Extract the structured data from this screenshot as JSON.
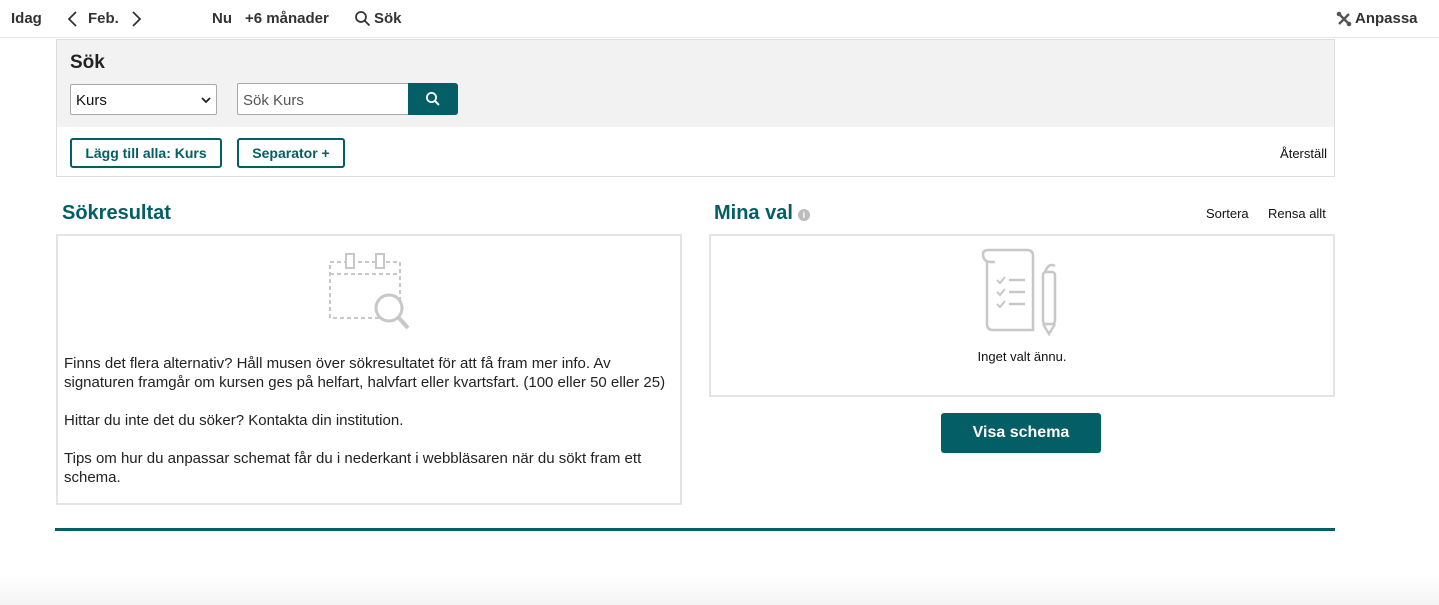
{
  "topbar": {
    "today": "Idag",
    "month": "Feb.",
    "now": "Nu",
    "plus_months": "+6 månader",
    "search": "Sök",
    "customize": "Anpassa"
  },
  "search": {
    "title": "Sök",
    "type_selected": "Kurs",
    "placeholder": "Sök Kurs",
    "add_all_label": "Lägg till alla: Kurs",
    "separator_label": "Separator +",
    "reset_label": "Återställ"
  },
  "results": {
    "heading": "Sökresultat",
    "paragraphs": [
      "Finns det flera alternativ? Håll musen över sökresultatet för att få fram mer info. Av signaturen framgår om kursen ges på helfart, halvfart eller kvartsfart. (100 eller 50 eller 25)",
      "Hittar du inte det du söker? Kontakta din institution.",
      "Tips om hur du anpassar schemat får du i nederkant i webbläsaren när du sökt fram ett schema."
    ]
  },
  "selection": {
    "heading": "Mina val",
    "info_icon": "i",
    "sort_label": "Sortera",
    "clear_label": "Rensa allt",
    "empty_text": "Inget valt ännu.",
    "show_schedule_label": "Visa schema"
  },
  "colors": {
    "accent": "#045e65",
    "icon_gray": "#c8c8c8"
  },
  "icons": [
    "chevron-left-icon",
    "chevron-right-icon",
    "search-icon",
    "tools-icon",
    "info-icon",
    "empty-calendar-search-icon",
    "checklist-pen-icon"
  ]
}
